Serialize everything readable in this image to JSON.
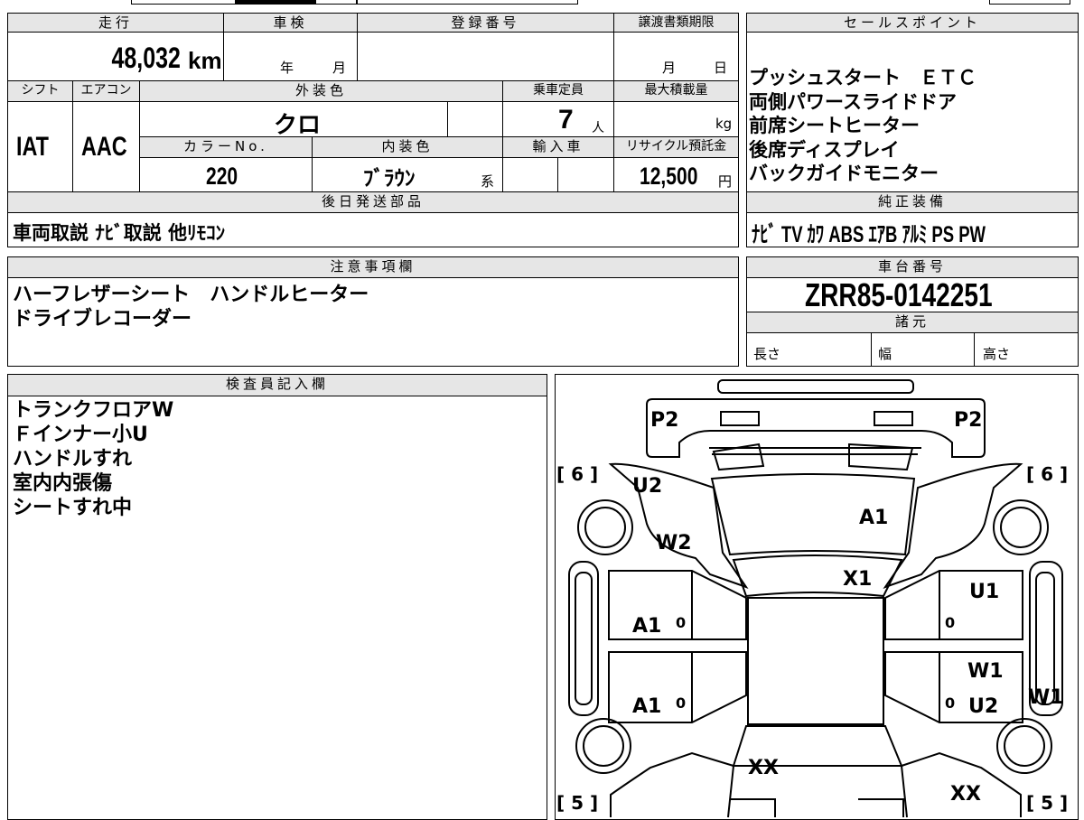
{
  "header": {
    "mileage_label": "走行",
    "shaken_label": "車検",
    "reg_label": "登録番号",
    "transfer_label": "譲渡書類期限",
    "sales_label": "セールスポイント"
  },
  "mileage": {
    "value": "48,032",
    "unit": "km"
  },
  "shaken": {
    "year": "年",
    "month": "月"
  },
  "transfer": {
    "month": "月",
    "day": "日"
  },
  "sales_points": "プッシュスタート　ＥＴＣ\n両側パワースライドドア\n前席シートヒーター\n後席ディスプレイ\nバックガイドモニター",
  "row2": {
    "shift_label": "シフト",
    "ac_label": "エアコン",
    "exterior_label": "外装色",
    "capacity_label": "乗車定員",
    "maxload_label": "最大積載量",
    "shift_value": "IAT",
    "ac_value": "AAC",
    "exterior_value": "クロ",
    "capacity_value": "7",
    "capacity_unit": "人",
    "maxload_unit": "kg",
    "colorno_label": "カラーNo.",
    "interior_label": "内装色",
    "import_label": "輸入車",
    "recycle_label": "リサイクル預託金",
    "colorno_value": "220",
    "interior_value": "ﾌﾞﾗｳﾝ",
    "interior_suffix": "系",
    "recycle_value": "12,500",
    "recycle_unit": "円"
  },
  "later_parts": {
    "label": "後日発送部品",
    "value": "車両取説 ﾅﾋﾞ取説 他ﾘﾓｺﾝ"
  },
  "genuine": {
    "label": "純正装備",
    "value": "ﾅﾋﾞ TV ｶﾜ ABS ｴｱB ｱﾙﾐ PS PW"
  },
  "notes": {
    "label": "注意事項欄",
    "value": "ハーフレザーシート　ハンドルヒーター\nドライブレコーダー"
  },
  "chassis": {
    "label": "車台番号",
    "value": "ZRR85-0142251"
  },
  "specs": {
    "label": "諸元",
    "length": "長さ",
    "width": "幅",
    "height": "高さ"
  },
  "inspector": {
    "label": "検査員記入欄",
    "value": "トランクフロアW\nＦインナー小U\nハンドルすれ\n室内内張傷\nシートすれ中"
  },
  "diagram": {
    "marks": {
      "p2_left": "P2",
      "p2_right": "P2",
      "six_left": "[ 6 ]",
      "six_right": "[ 6 ]",
      "five_left": "[ 5 ]",
      "five_right": "[ 5 ]",
      "u2_top": "U2",
      "w2": "W2",
      "a1_hood": "A1",
      "x1": "X1",
      "u1": "U1",
      "a1_front_door": "A1",
      "zero_1": "0",
      "zero_2": "0",
      "a1_rear_door": "A1",
      "zero_3": "0",
      "w1_right": "W1",
      "zero_4": "0",
      "u2_right": "U2",
      "w1_side": "W1",
      "xx_1": "XX",
      "xx_2": "XX"
    }
  }
}
